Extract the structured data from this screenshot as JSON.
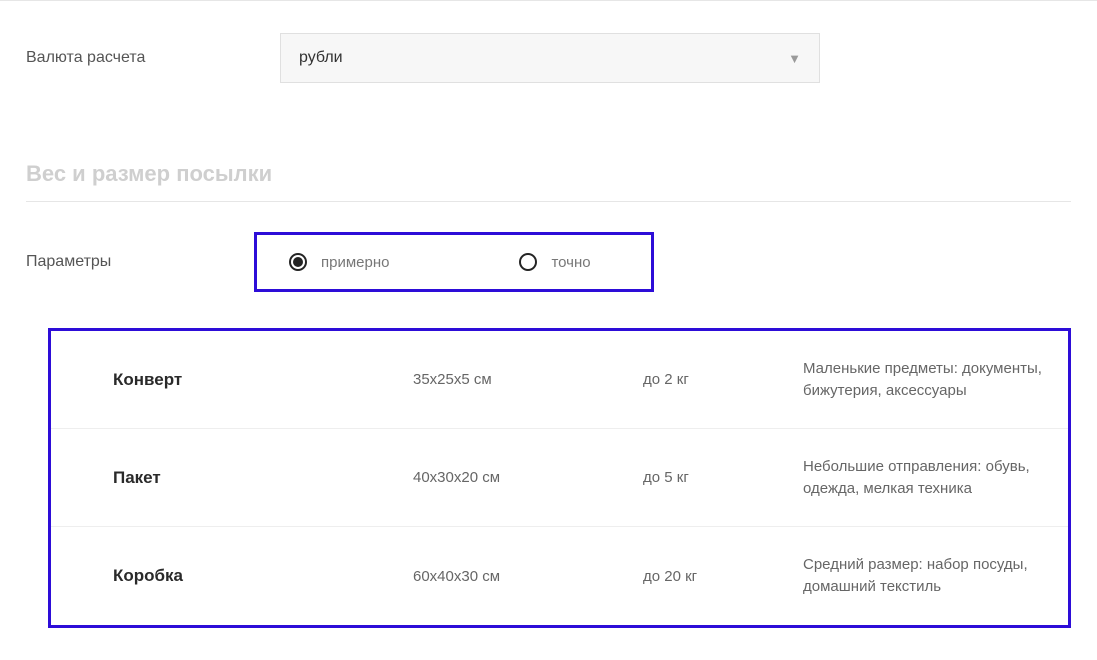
{
  "currency": {
    "label": "Валюта расчета",
    "value": "рубли"
  },
  "section": {
    "title": "Вес и размер посылки"
  },
  "params": {
    "label": "Параметры",
    "radios": {
      "approx": "примерно",
      "exact": "точно"
    }
  },
  "packages": [
    {
      "name": "Конверт",
      "dimensions": "35x25x5 см",
      "weight": "до 2 кг",
      "description": "Маленькие предметы: документы, бижутерия, аксессуары"
    },
    {
      "name": "Пакет",
      "dimensions": "40x30x20 см",
      "weight": "до 5 кг",
      "description": "Небольшие отправления: обувь, одежда, мелкая техника"
    },
    {
      "name": "Коробка",
      "dimensions": "60x40x30 см",
      "weight": "до 20 кг",
      "description": "Средний размер: набор посуды, домашний текстиль"
    }
  ]
}
